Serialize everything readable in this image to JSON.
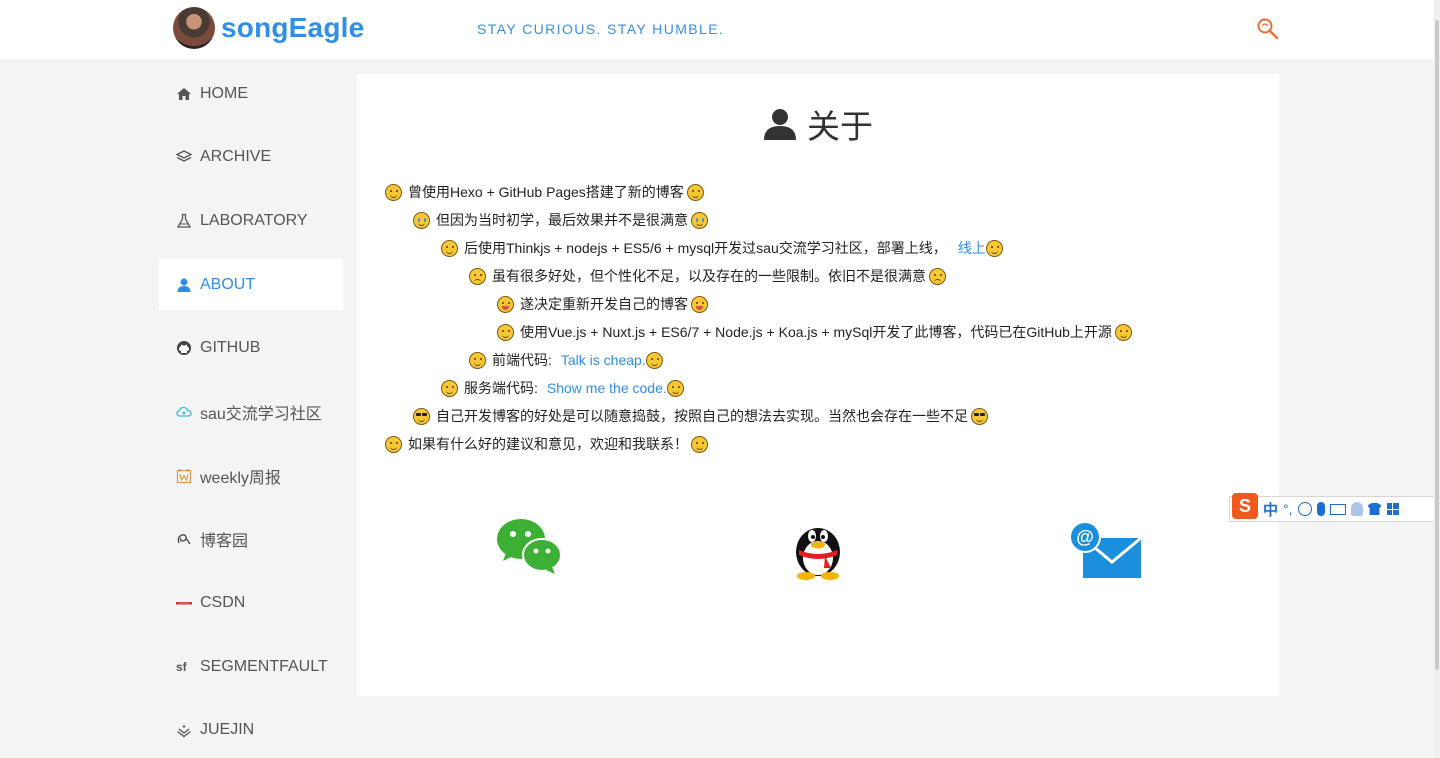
{
  "header": {
    "brand": "songEagle",
    "slogan": "STAY CURIOUS. STAY HUMBLE."
  },
  "sidebar": {
    "items": [
      {
        "label": "HOME",
        "icon": "home-icon",
        "active": false
      },
      {
        "label": "ARCHIVE",
        "icon": "archive-icon",
        "active": false
      },
      {
        "label": "LABORATORY",
        "icon": "flask-icon",
        "active": false
      },
      {
        "label": "ABOUT",
        "icon": "user-icon",
        "active": true
      },
      {
        "label": "GITHUB",
        "icon": "github-icon",
        "active": false
      },
      {
        "label": "sau交流学习社区",
        "icon": "cloud-icon",
        "active": false
      },
      {
        "label": "weekly周报",
        "icon": "weekly-icon",
        "active": false
      },
      {
        "label": "博客园",
        "icon": "cnblogs-icon",
        "active": false
      },
      {
        "label": "CSDN",
        "icon": "csdn-icon",
        "active": false
      },
      {
        "label": "SEGMENTFAULT",
        "icon": "segmentfault-icon",
        "active": false
      },
      {
        "label": "JUEJIN",
        "icon": "juejin-icon",
        "active": false
      }
    ]
  },
  "main": {
    "title": "关于",
    "lines": [
      {
        "text": "曾使用Hexo + GitHub Pages搭建了新的博客",
        "link": ""
      },
      {
        "text": "但因为当时初学，最后效果并不是很满意",
        "link": ""
      },
      {
        "text": "后使用Thinkjs + nodejs + ES5/6 + mysql开发过sau交流学习社区，部署上线，",
        "link": "线上"
      },
      {
        "text": "虽有很多好处，但个性化不足，以及存在的一些限制。依旧不是很满意",
        "link": ""
      },
      {
        "text": "遂决定重新开发自己的博客",
        "link": ""
      },
      {
        "text": "使用Vue.js + Nuxt.js + ES6/7 + Node.js + Koa.js + mySql开发了此博客，代码已在GitHub上开源",
        "link": ""
      },
      {
        "text": "前端代码:",
        "link": "Talk is cheap."
      },
      {
        "text": "服务端代码:",
        "link": "Show me the code."
      },
      {
        "text": "自己开发博客的好处是可以随意捣鼓，按照自己的想法去实现。当然也会存在一些不足",
        "link": ""
      },
      {
        "text": "如果有什么好的建议和意见，欢迎和我联系！",
        "link": ""
      }
    ],
    "contacts": [
      "wechat-icon",
      "qq-icon",
      "email-icon"
    ]
  },
  "ime_toolbar": {
    "label": "中"
  },
  "colors": {
    "accent": "#2f8ee8",
    "background": "#f4f4f4"
  }
}
